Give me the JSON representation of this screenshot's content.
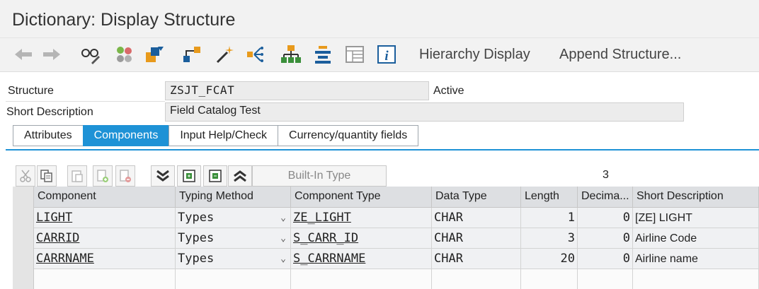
{
  "window": {
    "title": "Dictionary: Display Structure"
  },
  "toolbar": {
    "icons": [
      "back-arrow-icon",
      "forward-arrow-icon",
      "glasses-edit-icon",
      "other-object-icon",
      "activate-icon",
      "where-used-icon",
      "wand-icon",
      "navigate-icon",
      "hierarchy-icon",
      "stack-icon",
      "table-view-icon",
      "info-icon"
    ],
    "hierarchy_display": "Hierarchy Display",
    "append_structure": "Append Structure..."
  },
  "header": {
    "structure_label": "Structure",
    "structure_value": "ZSJT_FCAT",
    "status": "Active",
    "short_desc_label": "Short Description",
    "short_desc_value": "Field Catalog Test"
  },
  "tabs": [
    {
      "label": "Attributes",
      "active": false
    },
    {
      "label": "Components",
      "active": true
    },
    {
      "label": "Input Help/Check",
      "active": false
    },
    {
      "label": "Currency/quantity fields",
      "active": false
    }
  ],
  "table_toolbar": {
    "builtin_type": "Built-In Type",
    "count": "3"
  },
  "grid": {
    "columns": [
      "Component",
      "Typing Method",
      "Component Type",
      "Data Type",
      "Length",
      "Decima...",
      "Short Description"
    ],
    "rows": [
      {
        "component": "LIGHT",
        "typing": "Types",
        "comp_type": "ZE_LIGHT",
        "data_type": "CHAR",
        "length": "1",
        "decimals": "0",
        "desc": "[ZE] LIGHT"
      },
      {
        "component": "CARRID",
        "typing": "Types",
        "comp_type": "S_CARR_ID",
        "data_type": "CHAR",
        "length": "3",
        "decimals": "0",
        "desc": "Airline Code"
      },
      {
        "component": "CARRNAME",
        "typing": "Types",
        "comp_type": "S_CARRNAME",
        "data_type": "CHAR",
        "length": "20",
        "decimals": "0",
        "desc": "Airline name"
      }
    ]
  },
  "colors": {
    "accent": "#1e92d6",
    "toolbar_bg": "#f2f2f2",
    "header_cell": "#dddfe2"
  }
}
